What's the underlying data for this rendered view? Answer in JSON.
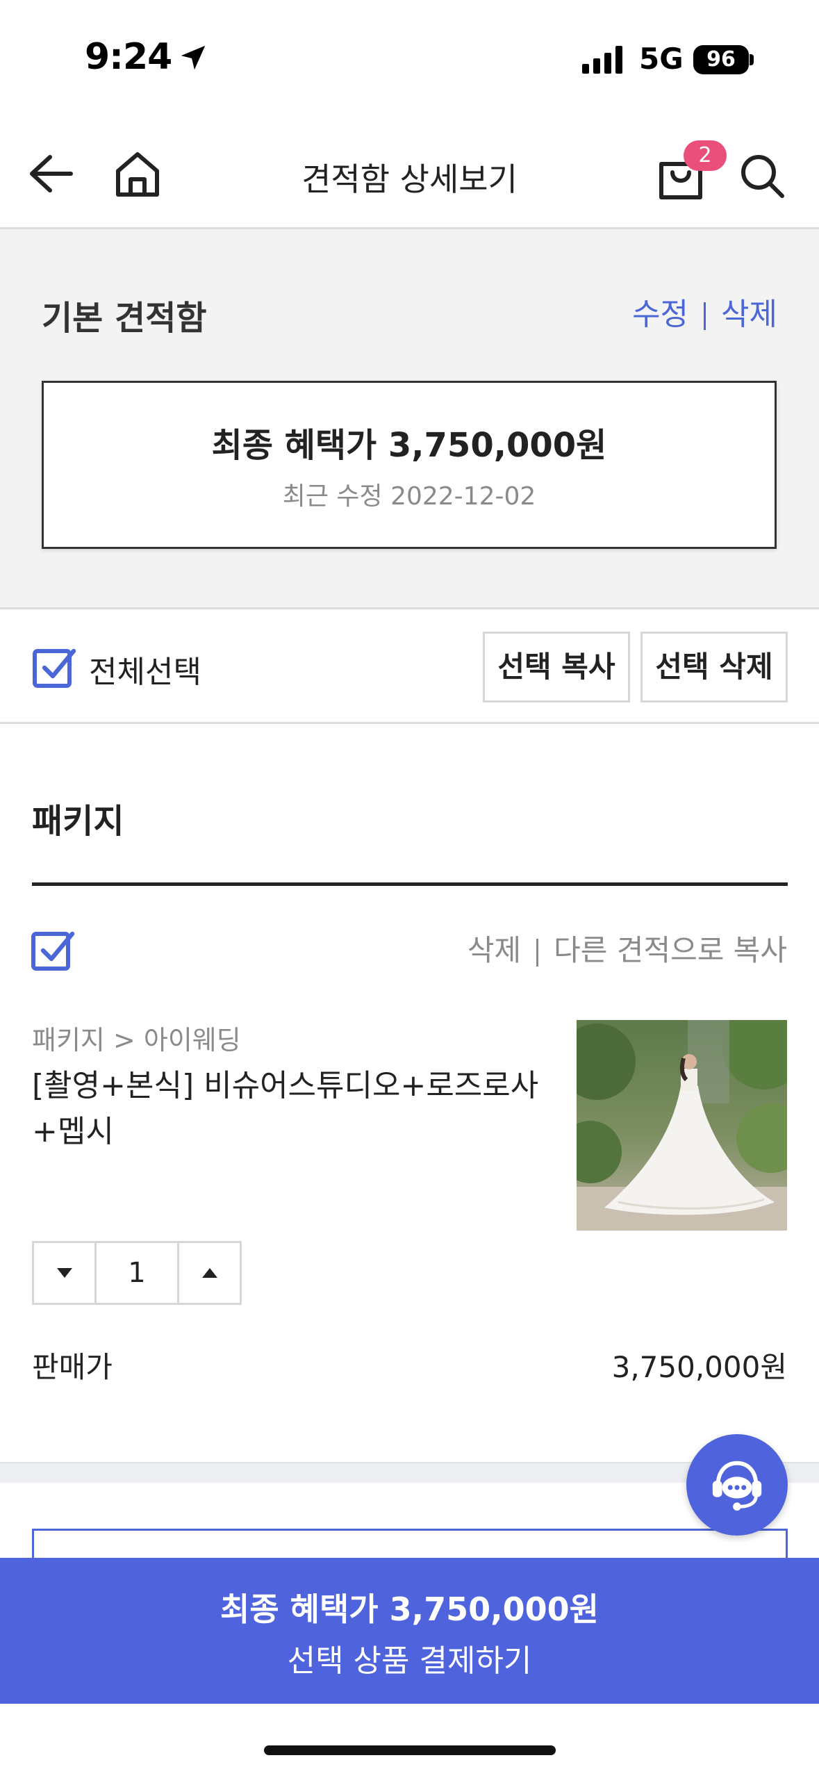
{
  "status_bar": {
    "time": "9:24",
    "network": "5G",
    "battery": "96"
  },
  "header": {
    "title": "견적함 상세보기",
    "cart_count": "2",
    "icons": [
      "back-arrow-icon",
      "home-icon",
      "cart-bag-icon",
      "search-icon"
    ]
  },
  "basket": {
    "name": "기본 견적함",
    "edit_label": "수정",
    "delete_label": "삭제",
    "final_price": "최종 혜택가 3,750,000원",
    "last_modified": "최근 수정 2022-12-02"
  },
  "selection": {
    "select_all_label": "전체선택",
    "select_all_checked": true,
    "copy_selected_label": "선택 복사",
    "delete_selected_label": "선택 삭제"
  },
  "package_section": {
    "title": "패키지",
    "item": {
      "checked": true,
      "delete_label": "삭제",
      "copy_label": "다른 견적으로 복사",
      "breadcrumb": "패키지 > 아이웨딩",
      "title": "[촬영+본식] 비슈어스튜디오+로즈로사+멥시",
      "quantity": "1",
      "price_label": "판매가",
      "price_value": "3,750,000원",
      "image": "wedding-dress-photo"
    }
  },
  "checkout": {
    "price": "최종 혜택가 3,750,000원",
    "label": "선택 상품 결제하기"
  },
  "colors": {
    "accent": "#4f63dc",
    "link": "#4b66d6",
    "badge": "#ea4f7b",
    "muted_text": "#8a8a8a"
  }
}
